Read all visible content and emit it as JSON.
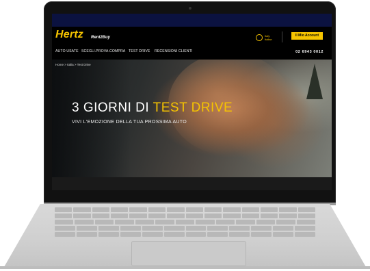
{
  "app": {
    "brand": "Hertz",
    "brand_sub": "Rent2Buy",
    "language_label": "Italy\nItalian",
    "account_button": "Il Mio Account"
  },
  "nav": {
    "items": [
      "AUTO USATE",
      "SCEGLI.PROVA.COMPRA",
      "TEST DRIVE",
      "RECENSIONI CLIENTI"
    ],
    "phone": "02 6943 0012"
  },
  "hero": {
    "breadcrumb": "Home > Italia > Test Drive",
    "title_main": "3 GIORNI DI ",
    "title_accent": "TEST DRIVE",
    "subtitle": "VIVI L'EMOZIONE DELLA TUA PROSSIMA AUTO"
  },
  "colors": {
    "brand_yellow": "#f6c400",
    "header_bg": "#000000",
    "top_strip": "#0b1240"
  },
  "icons": {
    "language": "globe-icon"
  }
}
